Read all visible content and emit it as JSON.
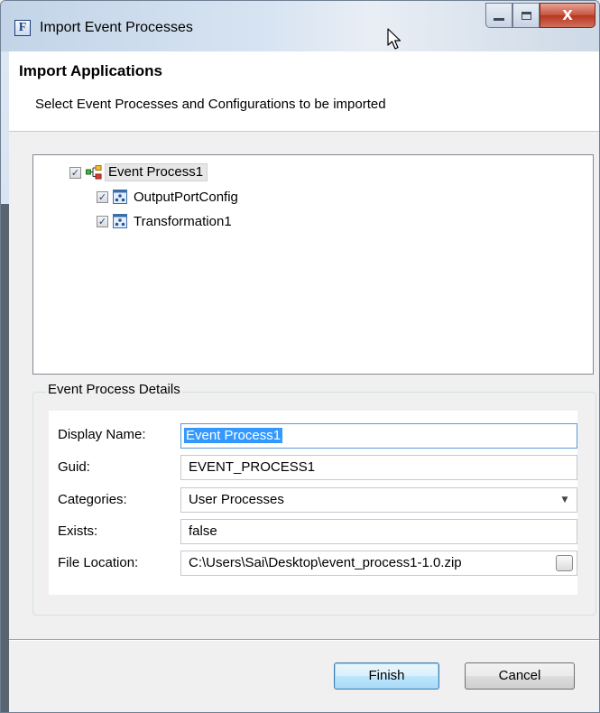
{
  "window": {
    "title": "Import Event Processes",
    "app_icon_letter": "F",
    "close_glyph": "X"
  },
  "banner": {
    "title": "Import Applications",
    "description": "Select Event Processes and Configurations to be imported"
  },
  "tree": {
    "root": {
      "label": "Event Process1",
      "checked": true,
      "icon": "event-process-icon"
    },
    "children": [
      {
        "label": "OutputPortConfig",
        "checked": true,
        "icon": "config-icon"
      },
      {
        "label": "Transformation1",
        "checked": true,
        "icon": "config-icon"
      }
    ]
  },
  "details": {
    "group_title": "Event Process Details",
    "fields": {
      "display_name": {
        "label": "Display Name:",
        "value": "Event Process1"
      },
      "guid": {
        "label": "Guid:",
        "value": "EVENT_PROCESS1"
      },
      "categories": {
        "label": "Categories:",
        "value": "User Processes"
      },
      "exists": {
        "label": "Exists:",
        "value": "false"
      },
      "file_location": {
        "label": "File Location:",
        "value": "C:\\Users\\Sai\\Desktop\\event_process1-1.0.zip"
      }
    }
  },
  "buttons": {
    "finish": "Finish",
    "cancel": "Cancel"
  },
  "colors": {
    "selection": "#3399ff",
    "focus_border": "#5b9bd5",
    "close_button": "#c7523c",
    "checkbox_tick": "#21478b"
  }
}
